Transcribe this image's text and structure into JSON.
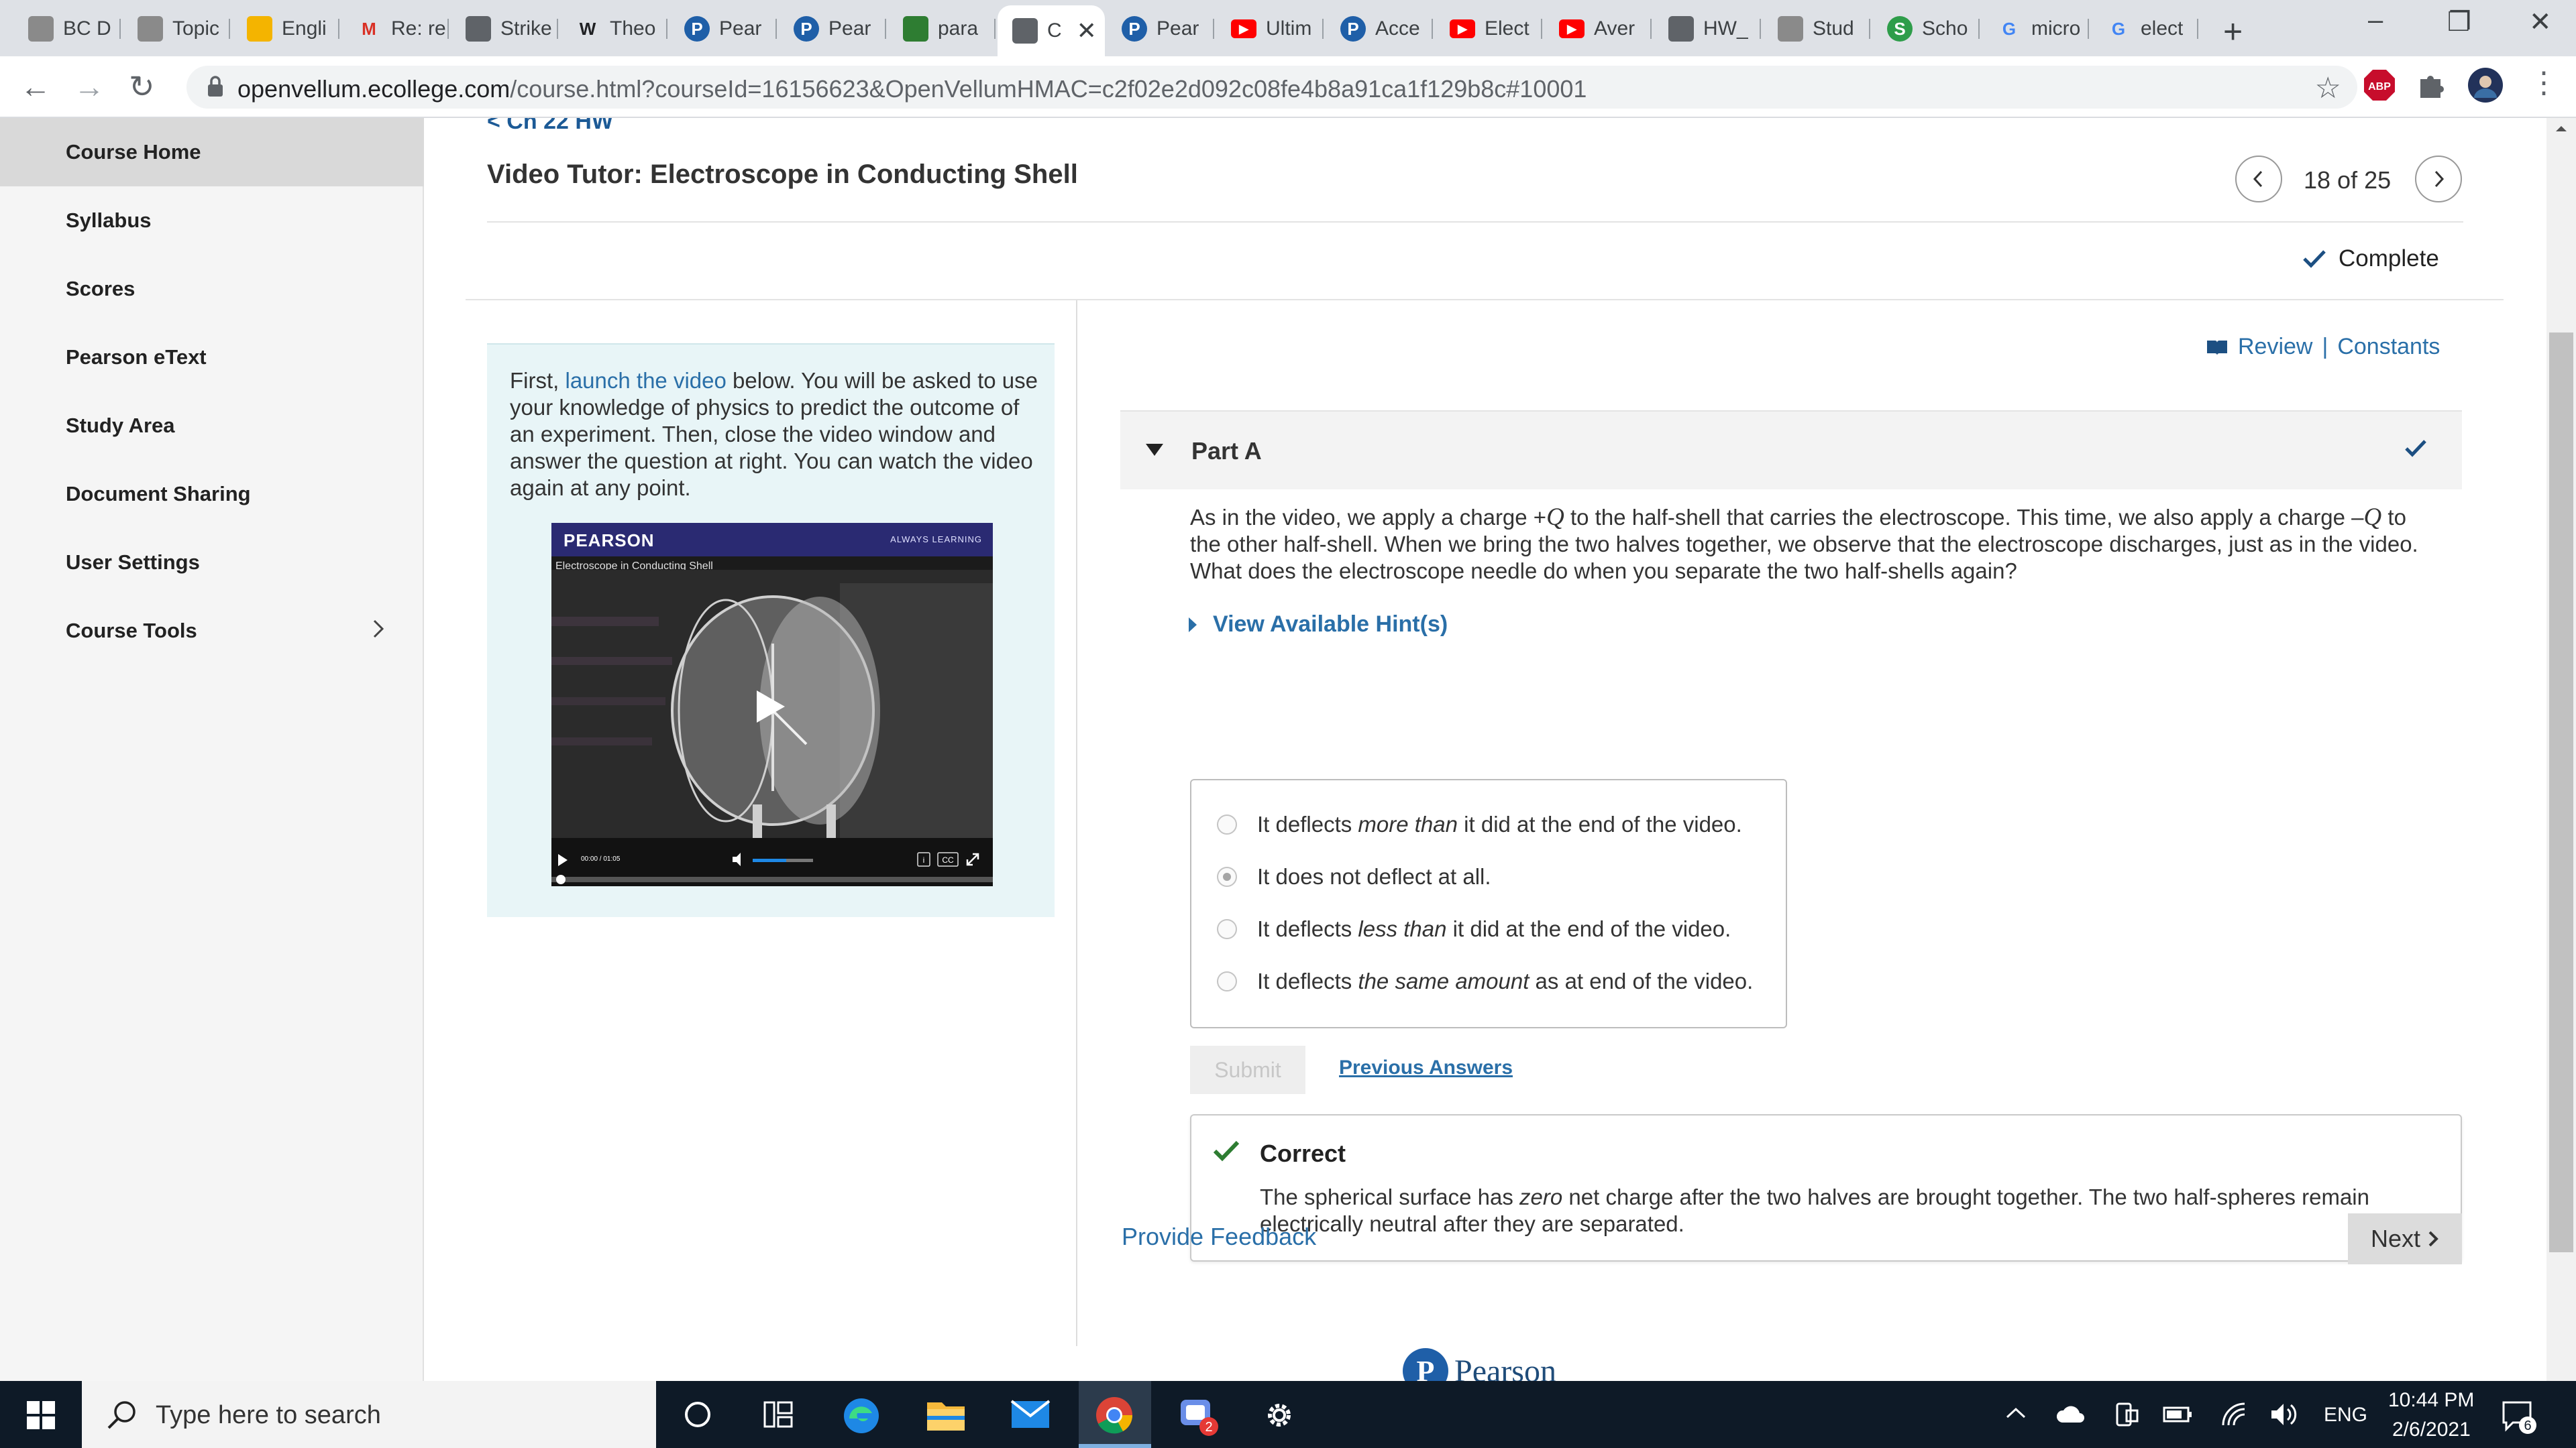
{
  "browser": {
    "tabs": [
      {
        "title": "BC D",
        "icon": "wolf-icon",
        "color": "#8a8a8a"
      },
      {
        "title": "Topic",
        "icon": "wolf-icon",
        "color": "#8a8a8a"
      },
      {
        "title": "Engli",
        "icon": "slides-icon",
        "color": "#f4b400"
      },
      {
        "title": "Re: re",
        "icon": "gmail-icon",
        "color": "#d93025"
      },
      {
        "title": "Strike",
        "icon": "image-icon",
        "color": "#5f6368"
      },
      {
        "title": "Theo",
        "icon": "wikipedia-icon",
        "color": "#202124"
      },
      {
        "title": "Pear",
        "icon": "pearson-icon",
        "color": "#1f5fa8"
      },
      {
        "title": "Pear",
        "icon": "pearson-icon",
        "color": "#1f5fa8"
      },
      {
        "title": "para",
        "icon": "leaf-icon",
        "color": "#2e7d32"
      },
      {
        "title": "C",
        "icon": "document-icon",
        "color": "#5f6368"
      },
      {
        "title": "Pear",
        "icon": "pearson-icon",
        "color": "#1f5fa8"
      },
      {
        "title": "Ultim",
        "icon": "youtube-icon",
        "color": "#ff0000"
      },
      {
        "title": "Acce",
        "icon": "pearson-icon",
        "color": "#1f5fa8"
      },
      {
        "title": "Elect",
        "icon": "youtube-icon",
        "color": "#ff0000"
      },
      {
        "title": "Aver",
        "icon": "youtube-icon",
        "color": "#ff0000"
      },
      {
        "title": "HW_",
        "icon": "globe-icon",
        "color": "#5f6368"
      },
      {
        "title": "Stud",
        "icon": "wolf-icon",
        "color": "#8a8a8a"
      },
      {
        "title": "Scho",
        "icon": "scholar-icon",
        "color": "#2e9d4a"
      },
      {
        "title": "micro",
        "icon": "google-icon",
        "color": "#4285f4"
      },
      {
        "title": "elect",
        "icon": "google-icon",
        "color": "#4285f4"
      }
    ],
    "url_host": "openvellum.ecollege.com",
    "url_path": "/course.html?courseId=16156623&OpenVellumHMAC=c2f02e2d092c08fe4b8a91ca1f129b8c#10001",
    "abp_label": "ABP"
  },
  "sidebar": {
    "items": [
      {
        "label": "Course Home",
        "active": true
      },
      {
        "label": "Syllabus"
      },
      {
        "label": "Scores"
      },
      {
        "label": "Pearson eText"
      },
      {
        "label": "Study Area"
      },
      {
        "label": "Document Sharing"
      },
      {
        "label": "User Settings"
      },
      {
        "label": "Course Tools",
        "has_arrow": true
      }
    ]
  },
  "header": {
    "breadcrumb": "< Ch 22 HW",
    "title": "Video Tutor: Electroscope in Conducting Shell",
    "position": "18 of 25",
    "status": "Complete"
  },
  "video_panel": {
    "intro_before": "First, ",
    "intro_link": "launch the video",
    "intro_after": " below. You will be asked to use your knowledge of physics to predict the outcome of an experiment. Then, close the video window and answer the question at right. You can watch the video again at any point.",
    "brand": "PEARSON",
    "tagline": "ALWAYS LEARNING",
    "video_title": "Electroscope in Conducting Shell",
    "time": "00:00 / 01:05",
    "cc": "CC",
    "info": "i"
  },
  "part": {
    "review": "Review",
    "review_sep": "|",
    "constants": "Constants",
    "label": "Part A",
    "question_1": "As in the video, we apply a charge +",
    "question_q1": "Q",
    "question_2": " to the half-shell that carries the electroscope. This time, we also apply a charge –",
    "question_q2": "Q",
    "question_3": " to the other half-shell. When we bring the two halves together, we observe that the electroscope discharges, just as in the video. What does the electroscope needle do when you separate the two half-shells again?",
    "hints": "View Available Hint(s)",
    "choices": [
      {
        "pre": "It deflects ",
        "em": "more than",
        "post": " it did at the end of the video.",
        "selected": false
      },
      {
        "pre": "It does not deflect at all.",
        "em": "",
        "post": "",
        "selected": true
      },
      {
        "pre": "It deflects ",
        "em": "less than",
        "post": " it did at the end of the video.",
        "selected": false
      },
      {
        "pre": "It deflects ",
        "em": "the same amount",
        "post": " as at end of the video.",
        "selected": false
      }
    ],
    "submit": "Submit",
    "previous": "Previous Answers",
    "result_title": "Correct",
    "result_1": "The spherical surface has ",
    "result_em": "zero",
    "result_2": " net charge after the two halves are brought together. The two half-spheres remain electrically neutral after they are separated."
  },
  "footer": {
    "feedback": "Provide Feedback",
    "next": "Next",
    "logo": "Pearson"
  },
  "taskbar": {
    "search_placeholder": "Type here to search",
    "lang": "ENG",
    "time": "10:44 PM",
    "date": "2/6/2021",
    "notifications": "6",
    "badge": "2"
  },
  "colors": {
    "link": "#2a6fa8",
    "correct": "#2e7d32",
    "taskbar": "#0e1a27",
    "panel": "#e8f5f7"
  }
}
